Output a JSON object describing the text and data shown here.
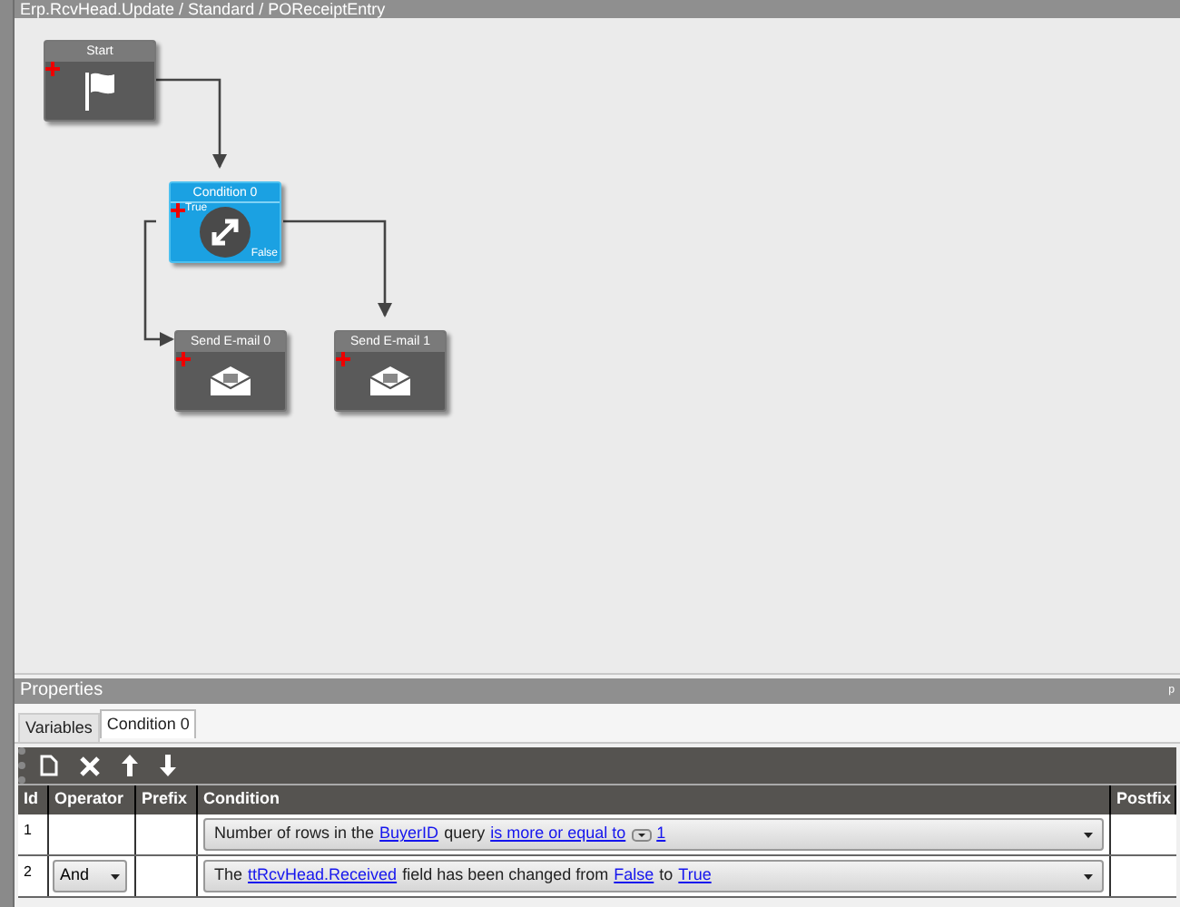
{
  "header": {
    "title": "Erp.RcvHead.Update / Standard / POReceiptEntry"
  },
  "nodes": [
    {
      "title": "Start",
      "kind": "start",
      "selected": false
    },
    {
      "title": "Condition 0",
      "kind": "condition",
      "selected": true,
      "true_label": "True",
      "false_label": "False"
    },
    {
      "title": "Send E-mail 0",
      "kind": "action",
      "selected": false
    },
    {
      "title": "Send E-mail 1",
      "kind": "action",
      "selected": false
    }
  ],
  "properties": {
    "title": "Properties",
    "pin": "ᵖ",
    "tabs": [
      {
        "label": "Variables",
        "selected": false
      },
      {
        "label": "Condition 0",
        "selected": true
      }
    ],
    "table": {
      "columns": [
        "Id",
        "Operator",
        "Prefix",
        "Condition",
        "Postfix"
      ],
      "rows": [
        {
          "id": "1",
          "condition": [
            {
              "kind": "text",
              "text": "Number of rows in the"
            },
            {
              "kind": "link",
              "text": "BuyerID"
            },
            {
              "kind": "text",
              "text": "query"
            },
            {
              "kind": "link",
              "text": "is more or equal to"
            },
            {
              "kind": "dropdown"
            },
            {
              "kind": "link",
              "text": "1"
            }
          ]
        },
        {
          "id": "2",
          "operator": "And",
          "condition": [
            {
              "kind": "text",
              "text": "The"
            },
            {
              "kind": "link",
              "text": "ttRcvHead.Received"
            },
            {
              "kind": "text",
              "text": "field has been changed from"
            },
            {
              "kind": "link",
              "text": "False"
            },
            {
              "kind": "text",
              "text": "to"
            },
            {
              "kind": "link",
              "text": "True"
            }
          ]
        }
      ]
    }
  }
}
